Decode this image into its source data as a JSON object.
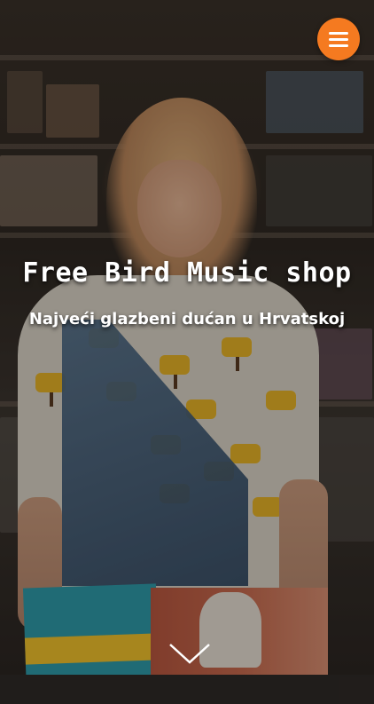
{
  "header": {
    "menu_icon": "hamburger-menu-icon",
    "accent_color": "#f57a20"
  },
  "hero": {
    "title": "Free Bird Music shop",
    "subtitle": "Najveći glazbeni dućan u Hrvatskoj",
    "background_image": "woman-browsing-vinyl-records-photo",
    "scroll_icon": "chevron-down-icon"
  }
}
